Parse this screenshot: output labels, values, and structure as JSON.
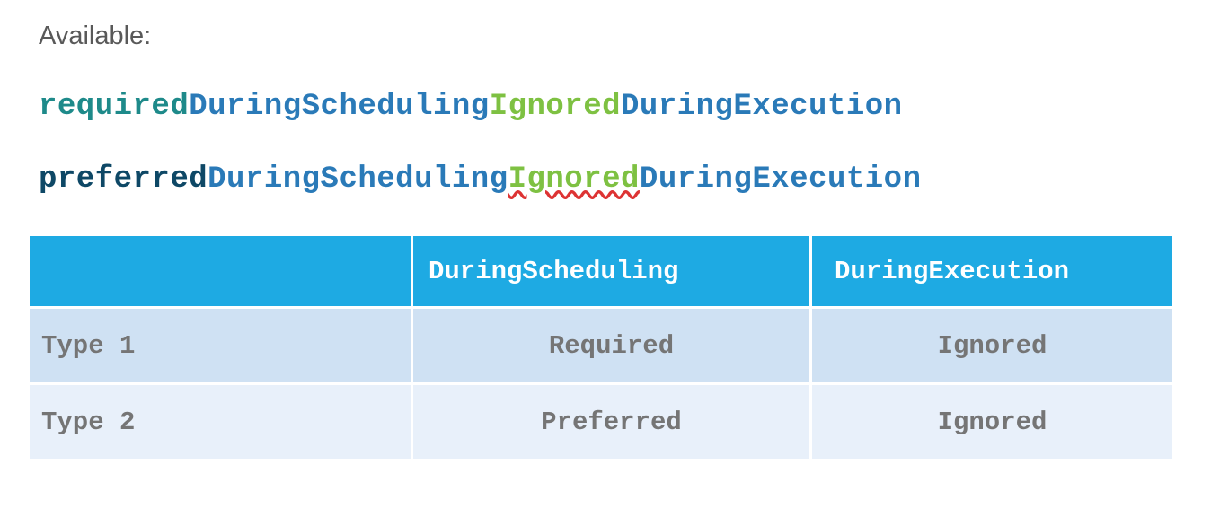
{
  "heading": "Available:",
  "lines": [
    {
      "segments": [
        {
          "text": "required",
          "color": "#1e8a8a"
        },
        {
          "text": "DuringScheduling",
          "color": "#2a7ab8"
        },
        {
          "text": "Ignored",
          "color": "#7ec142"
        },
        {
          "text": "DuringExecution",
          "color": "#2a7ab8"
        }
      ]
    },
    {
      "segments": [
        {
          "text": "preferred",
          "color": "#0e4866"
        },
        {
          "text": "DuringScheduling",
          "color": "#2a7ab8"
        },
        {
          "text": "Ignored",
          "color": "#7ec142"
        },
        {
          "text": "DuringExecution",
          "color": "#2a7ab8"
        }
      ]
    }
  ],
  "table": {
    "headers": [
      "",
      "DuringScheduling",
      "DuringExecution"
    ],
    "rows": [
      {
        "label": "Type 1",
        "during_scheduling": "Required",
        "during_execution": "Ignored"
      },
      {
        "label": "Type 2",
        "during_scheduling": "Preferred",
        "during_execution": "Ignored"
      }
    ],
    "header_color": "#1eaae3",
    "row_colors": [
      "#cfe1f3",
      "#e8f0fa"
    ]
  }
}
